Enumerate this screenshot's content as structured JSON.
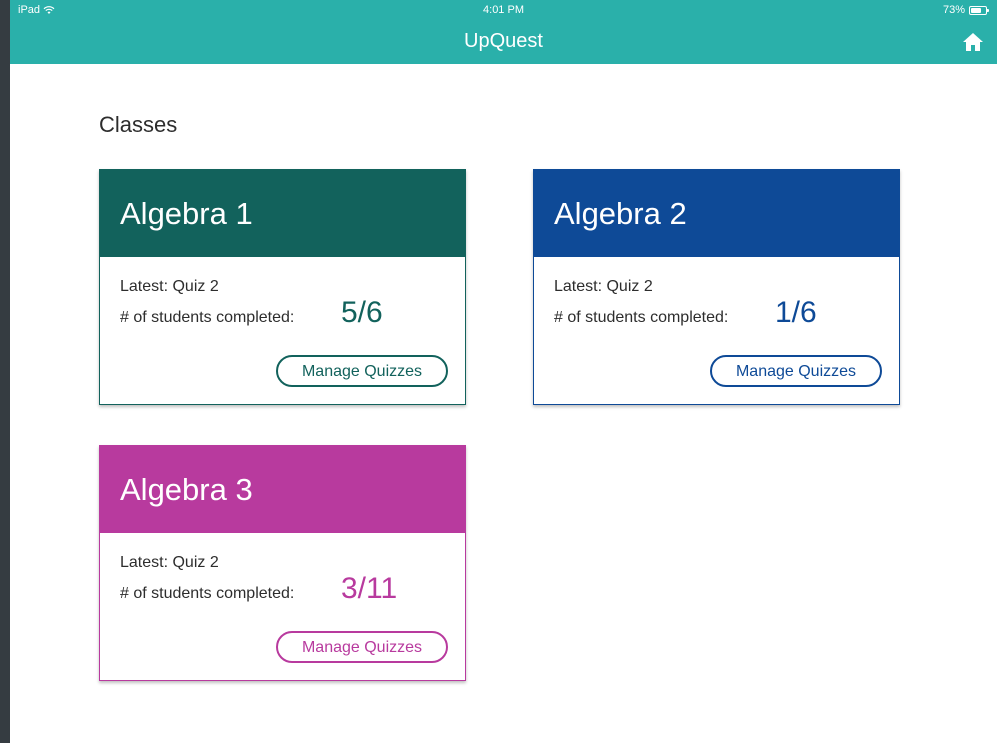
{
  "status_bar": {
    "carrier": "iPad",
    "time": "4:01 PM",
    "battery": "73%",
    "battery_level": 0.73
  },
  "header": {
    "title": "UpQuest",
    "home_icon": "home-icon"
  },
  "main": {
    "section_title": "Classes",
    "classes": [
      {
        "name": "Algebra 1",
        "latest": "Latest: Quiz 2",
        "completed_label": "# of students completed:",
        "completed": "5/6",
        "button": "Manage Quizzes",
        "color": "#12625c"
      },
      {
        "name": "Algebra 2",
        "latest": "Latest: Quiz 2",
        "completed_label": "# of students completed:",
        "completed": "1/6",
        "button": "Manage Quizzes",
        "color": "#0e4a97"
      },
      {
        "name": "Algebra 3",
        "latest": "Latest: Quiz 2",
        "completed_label": "# of students completed:",
        "completed": "3/11",
        "button": "Manage Quizzes",
        "color": "#b83a9e"
      }
    ]
  },
  "colors": {
    "header_bg": "#2ab0aa",
    "page_bg": "#ffffff"
  }
}
